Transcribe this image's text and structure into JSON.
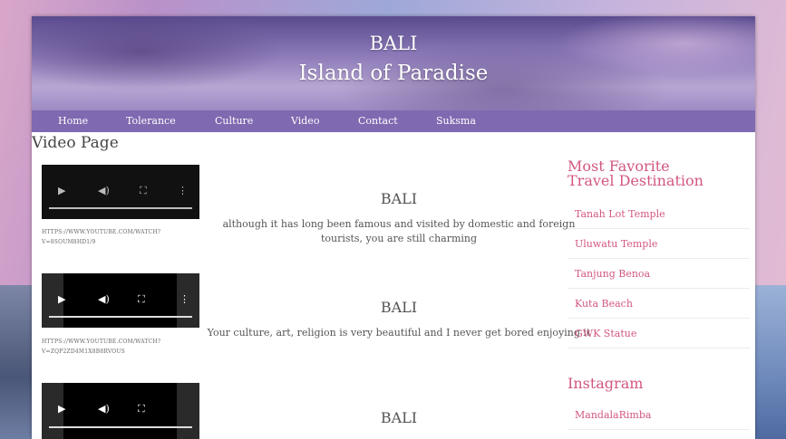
{
  "header": {
    "title": "BALI",
    "subtitle": "Island of Paradise"
  },
  "nav": {
    "items": [
      "Home",
      "Tolerance",
      "Culture",
      "Video",
      "Contact",
      "Suksma"
    ]
  },
  "main": {
    "page_title": "Video Page",
    "videos": [
      {
        "link_line1": "HTTPS://WWW.YOUTUBE.COM/WATCH?",
        "link_line2": "V=8SOUM8HD1/9"
      },
      {
        "link_line1": "HTTPS://WWW.YOUTUBE.COM/WATCH?",
        "link_line2": "V=ZQP2ZD4M1X8B8RVOUS"
      },
      {
        "link_line1": "",
        "link_line2": ""
      }
    ],
    "articles": [
      {
        "heading": "BALI",
        "text": "although it has long been famous and visited by domestic and foreign tourists, you are still charming"
      },
      {
        "heading": "BALI",
        "text": "Your culture, art, religion is very beautiful and I never get bored enjoying it"
      },
      {
        "heading": "BALI",
        "text": ""
      }
    ]
  },
  "sidebar": {
    "favorites_title_line1": "Most Favorite",
    "favorites_title_line2": "Travel Destination",
    "favorites": [
      "Tanah Lot Temple",
      "Uluwatu Temple",
      "Tanjung Benoa",
      "Kuta Beach",
      "GWK Statue"
    ],
    "instagram_title": "Instagram",
    "instagram": [
      "MandalaRimba"
    ]
  },
  "colors": {
    "nav_bg": "#7f69b0",
    "sidebar_accent": "#d2577f"
  },
  "icons": [
    "play-icon",
    "volume-icon",
    "fullscreen-icon",
    "more-options-icon"
  ]
}
